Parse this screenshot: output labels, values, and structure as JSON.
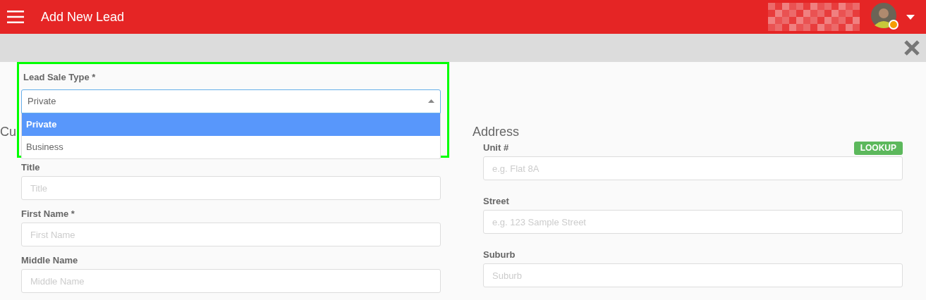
{
  "app_bar": {
    "title": "Add New Lead"
  },
  "lead_sale_type": {
    "label": "Lead Sale Type *",
    "value": "Private",
    "expanded": true,
    "options": [
      {
        "label": "Private",
        "selected": true
      },
      {
        "label": "Business",
        "selected": false
      }
    ]
  },
  "sections": [
    {
      "heading": "Cu",
      "fields": [
        {
          "label": "Title",
          "placeholder": "Title"
        },
        {
          "label": "First Name *",
          "placeholder": "First Name"
        },
        {
          "label": "Middle Name",
          "placeholder": "Middle Name"
        }
      ]
    },
    {
      "heading": "Address",
      "fields": [
        {
          "label": "Unit #",
          "placeholder": "e.g. Flat 8A",
          "action": "LOOKUP"
        },
        {
          "label": "Street",
          "placeholder": "e.g. 123 Sample Street"
        },
        {
          "label": "Suburb",
          "placeholder": "Suburb"
        }
      ]
    }
  ]
}
